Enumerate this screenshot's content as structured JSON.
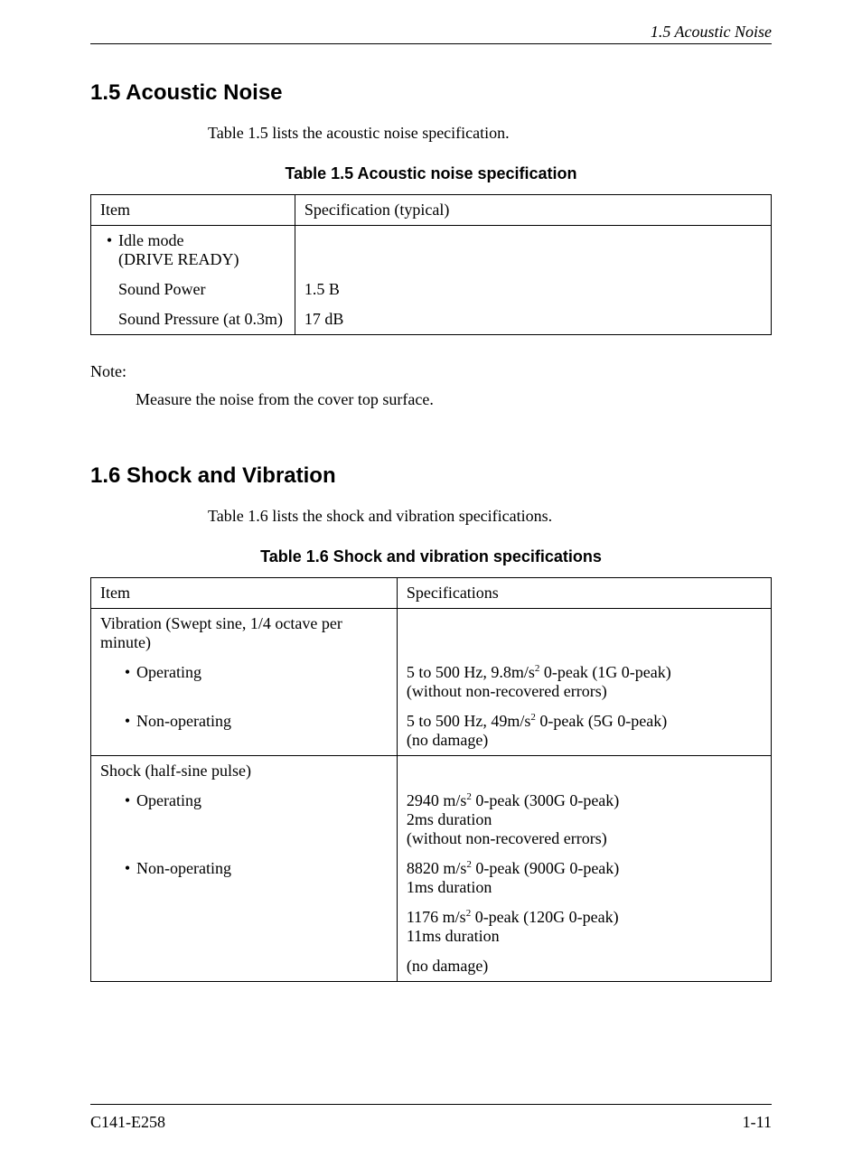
{
  "header": {
    "section_label": "1.5  Acoustic Noise"
  },
  "sections": {
    "s15": {
      "heading": "1.5  Acoustic Noise",
      "intro": "Table 1.5 lists the acoustic noise specification.",
      "table_caption": "Table 1.5  Acoustic noise specification",
      "table": {
        "col1_header": "Item",
        "col2_header": "Specification (typical)",
        "rows": [
          {
            "item_bullet": "•",
            "item_text": "Idle mode\n(DRIVE READY)",
            "spec": ""
          },
          {
            "item_text": "Sound Power",
            "spec": "1.5 B"
          },
          {
            "item_text": "Sound Pressure (at 0.3m)",
            "spec": "17 dB"
          }
        ]
      },
      "note_label": "Note:",
      "note_body": "Measure the noise from the cover top surface."
    },
    "s16": {
      "heading": "1.6  Shock and Vibration",
      "intro": "Table 1.6 lists the shock and vibration specifications.",
      "table_caption": "Table 1.6  Shock and vibration specifications",
      "table": {
        "col1_header": "Item",
        "col2_header": "Specifications",
        "groups": [
          {
            "title": "Vibration (Swept sine, 1/4 octave per minute)",
            "rows": [
              {
                "item_bullet": "•",
                "item_text": "Operating",
                "spec_pre": "5 to 500 Hz, 9.8m/s",
                "spec_sup": "2",
                "spec_post": " 0-peak (1G 0-peak)\n(without non-recovered errors)"
              },
              {
                "item_bullet": "•",
                "item_text": "Non-operating",
                "spec_pre": "5 to 500 Hz, 49m/s",
                "spec_sup": "2",
                "spec_post": " 0-peak (5G 0-peak)\n(no damage)"
              }
            ]
          },
          {
            "title": "Shock (half-sine pulse)",
            "rows": [
              {
                "item_bullet": "•",
                "item_text": "Operating",
                "spec_pre": "2940 m/s",
                "spec_sup": "2",
                "spec_post": " 0-peak (300G 0-peak)\n2ms duration\n(without non-recovered errors)"
              },
              {
                "item_bullet": "•",
                "item_text": "Non-operating",
                "spec_pre": "8820 m/s",
                "spec_sup": "2",
                "spec_post": " 0-peak (900G 0-peak)\n1ms duration"
              },
              {
                "item_bullet": "",
                "item_text": "",
                "spec_pre": "1176 m/s",
                "spec_sup": "2",
                "spec_post": " 0-peak (120G 0-peak)\n11ms duration"
              },
              {
                "item_bullet": "",
                "item_text": "",
                "spec_pre": "(no damage)",
                "spec_sup": "",
                "spec_post": ""
              }
            ]
          }
        ]
      }
    }
  },
  "footer": {
    "left": "C141-E258",
    "right": "1-11"
  }
}
